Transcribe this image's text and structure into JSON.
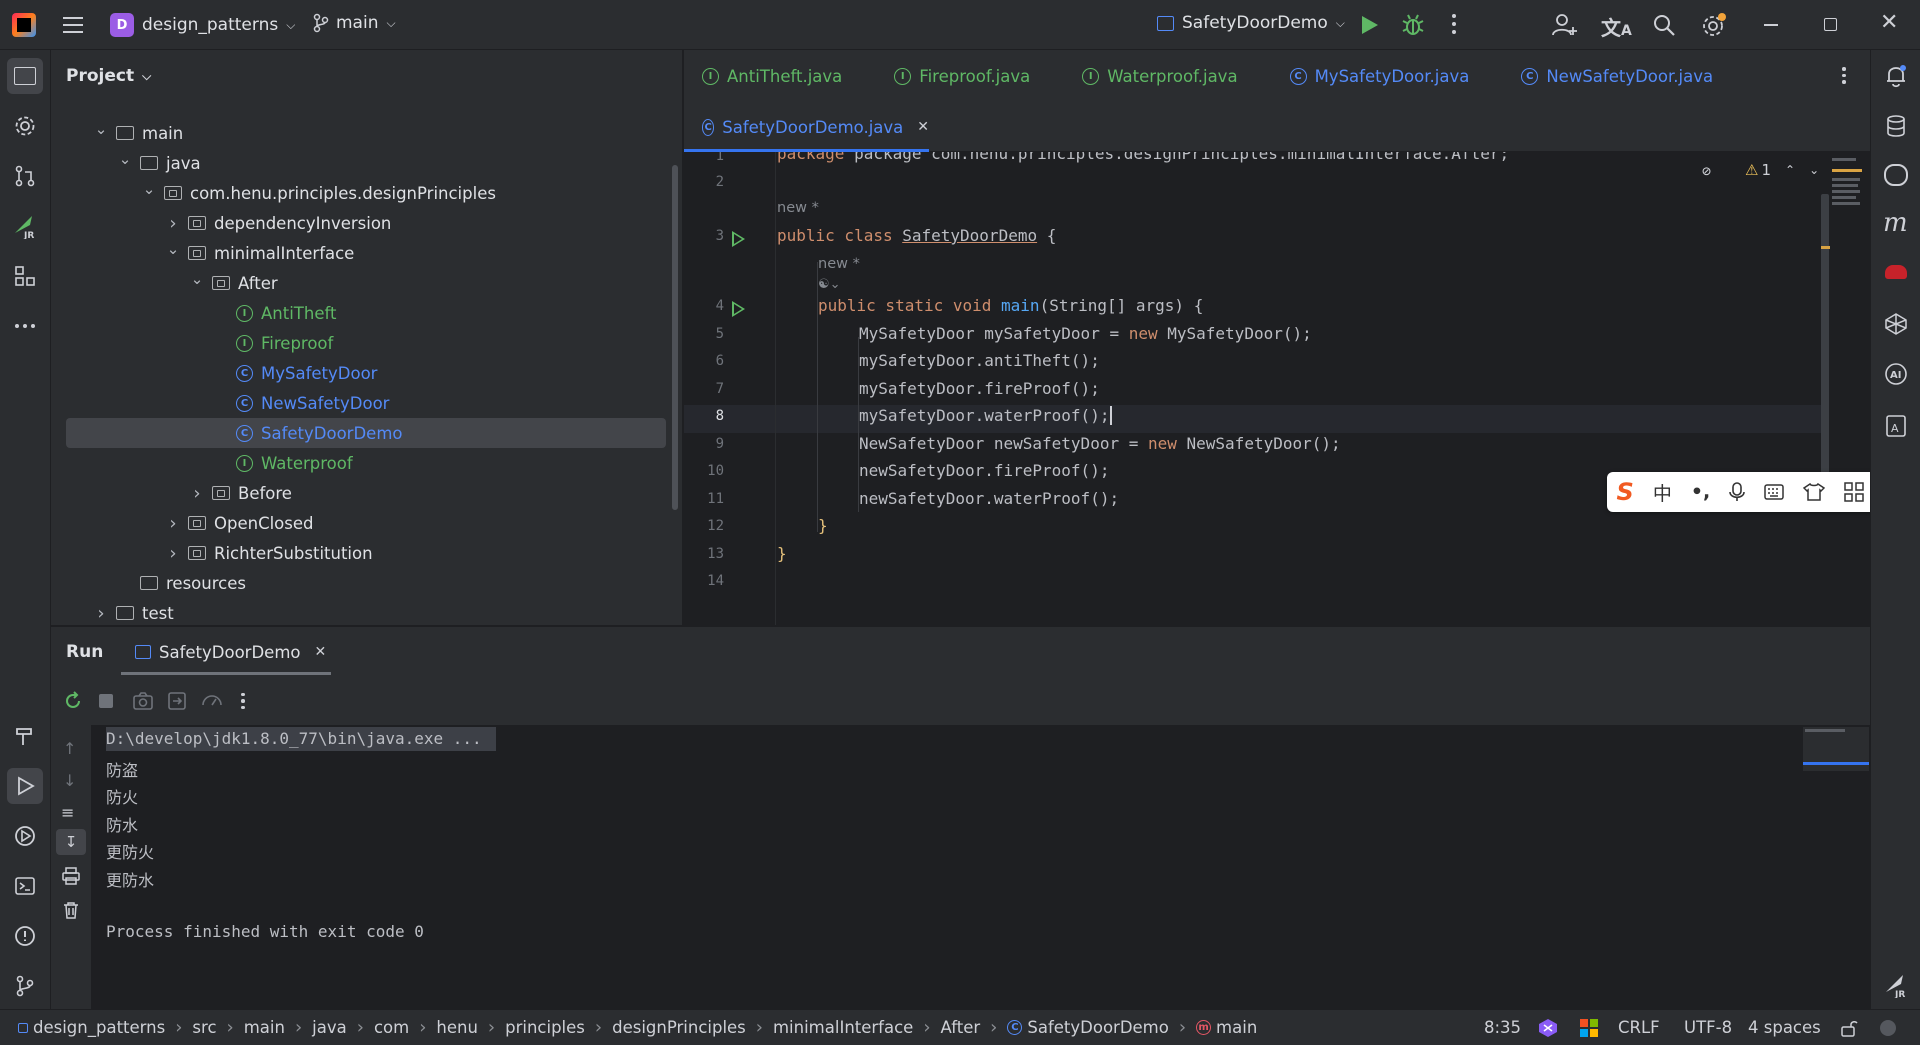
{
  "titlebar": {
    "project_badge": "D",
    "project_name": "design_patterns",
    "branch": "main",
    "run_config": "SafetyDoorDemo"
  },
  "project_panel": {
    "title": "Project",
    "tree": [
      {
        "label": "main",
        "type": "folder",
        "expanded": true,
        "depth": 0
      },
      {
        "label": "java",
        "type": "folder",
        "expanded": true,
        "depth": 1
      },
      {
        "label": "com.henu.principles.designPrinciples",
        "type": "package",
        "expanded": true,
        "depth": 2
      },
      {
        "label": "dependencyInversion",
        "type": "package",
        "expanded": false,
        "depth": 3
      },
      {
        "label": "minimalInterface",
        "type": "package",
        "expanded": true,
        "depth": 3
      },
      {
        "label": "After",
        "type": "package",
        "expanded": true,
        "depth": 4
      },
      {
        "label": "AntiTheft",
        "type": "interface",
        "depth": 5
      },
      {
        "label": "Fireproof",
        "type": "interface",
        "depth": 5
      },
      {
        "label": "MySafetyDoor",
        "type": "class",
        "depth": 5
      },
      {
        "label": "NewSafetyDoor",
        "type": "class",
        "depth": 5
      },
      {
        "label": "SafetyDoorDemo",
        "type": "class",
        "depth": 5,
        "selected": true
      },
      {
        "label": "Waterproof",
        "type": "interface",
        "depth": 5
      },
      {
        "label": "Before",
        "type": "package",
        "expanded": false,
        "depth": 4
      },
      {
        "label": "OpenClosed",
        "type": "package",
        "expanded": false,
        "depth": 3
      },
      {
        "label": "RichterSubstitution",
        "type": "package",
        "expanded": false,
        "depth": 3
      },
      {
        "label": "resources",
        "type": "folder",
        "depth": 1
      },
      {
        "label": "test",
        "type": "folder",
        "expanded": false,
        "depth": 0
      }
    ]
  },
  "editor": {
    "tabs_row1": [
      {
        "label": "AntiTheft.java",
        "kind": "interface"
      },
      {
        "label": "Fireproof.java",
        "kind": "interface"
      },
      {
        "label": "Waterproof.java",
        "kind": "interface"
      },
      {
        "label": "MySafetyDoor.java",
        "kind": "class"
      },
      {
        "label": "NewSafetyDoor.java",
        "kind": "class"
      }
    ],
    "active_tab": "SafetyDoorDemo.java",
    "warning_count": "1",
    "hint_new": "new *",
    "line_numbers": [
      "1",
      "2",
      "3",
      "4",
      "5",
      "6",
      "7",
      "8",
      "9",
      "10",
      "11",
      "12",
      "13",
      "14"
    ],
    "code": {
      "l1": "package com.henu.principles.designPrinciples.minimalInterface.After;",
      "l3_kw": "public class ",
      "l3_name": "SafetyDoorDemo",
      "l3_end": " {",
      "l4_kw": "public static void ",
      "l4_fn": "main",
      "l4_end": "(String[] args) {",
      "l5_a": "MySafetyDoor mySafetyDoor = ",
      "l5_kw": "new ",
      "l5_b": "MySafetyDoor();",
      "l6": "mySafetyDoor.antiTheft();",
      "l7": "mySafetyDoor.fireProof();",
      "l8": "mySafetyDoor.waterProof();",
      "l9_a": "NewSafetyDoor newSafetyDoor = ",
      "l9_kw": "new ",
      "l9_b": "NewSafetyDoor();",
      "l10": "newSafetyDoor.fireProof();",
      "l11": "newSafetyDoor.waterProof();",
      "l12": "}",
      "l13": "}"
    }
  },
  "run_panel": {
    "title": "Run",
    "tab": "SafetyDoorDemo",
    "console": [
      "D:\\develop\\jdk1.8.0_77\\bin\\java.exe ...",
      "防盗",
      "防火",
      "防水",
      "更防火",
      "更防水",
      "",
      "Process finished with exit code 0"
    ]
  },
  "statusbar": {
    "breadcrumbs": [
      "design_patterns",
      "src",
      "main",
      "java",
      "com",
      "henu",
      "principles",
      "designPrinciples",
      "minimalInterface",
      "After",
      "SafetyDoorDemo",
      "main"
    ],
    "position": "8:35",
    "line_sep": "CRLF",
    "encoding": "UTF-8",
    "indent": "4 spaces"
  },
  "ime": {
    "lang": "中"
  },
  "colors": {
    "accent": "#3574f0",
    "interface_green": "#5fb865",
    "class_blue": "#548af7",
    "keyword": "#cf8e6d"
  }
}
